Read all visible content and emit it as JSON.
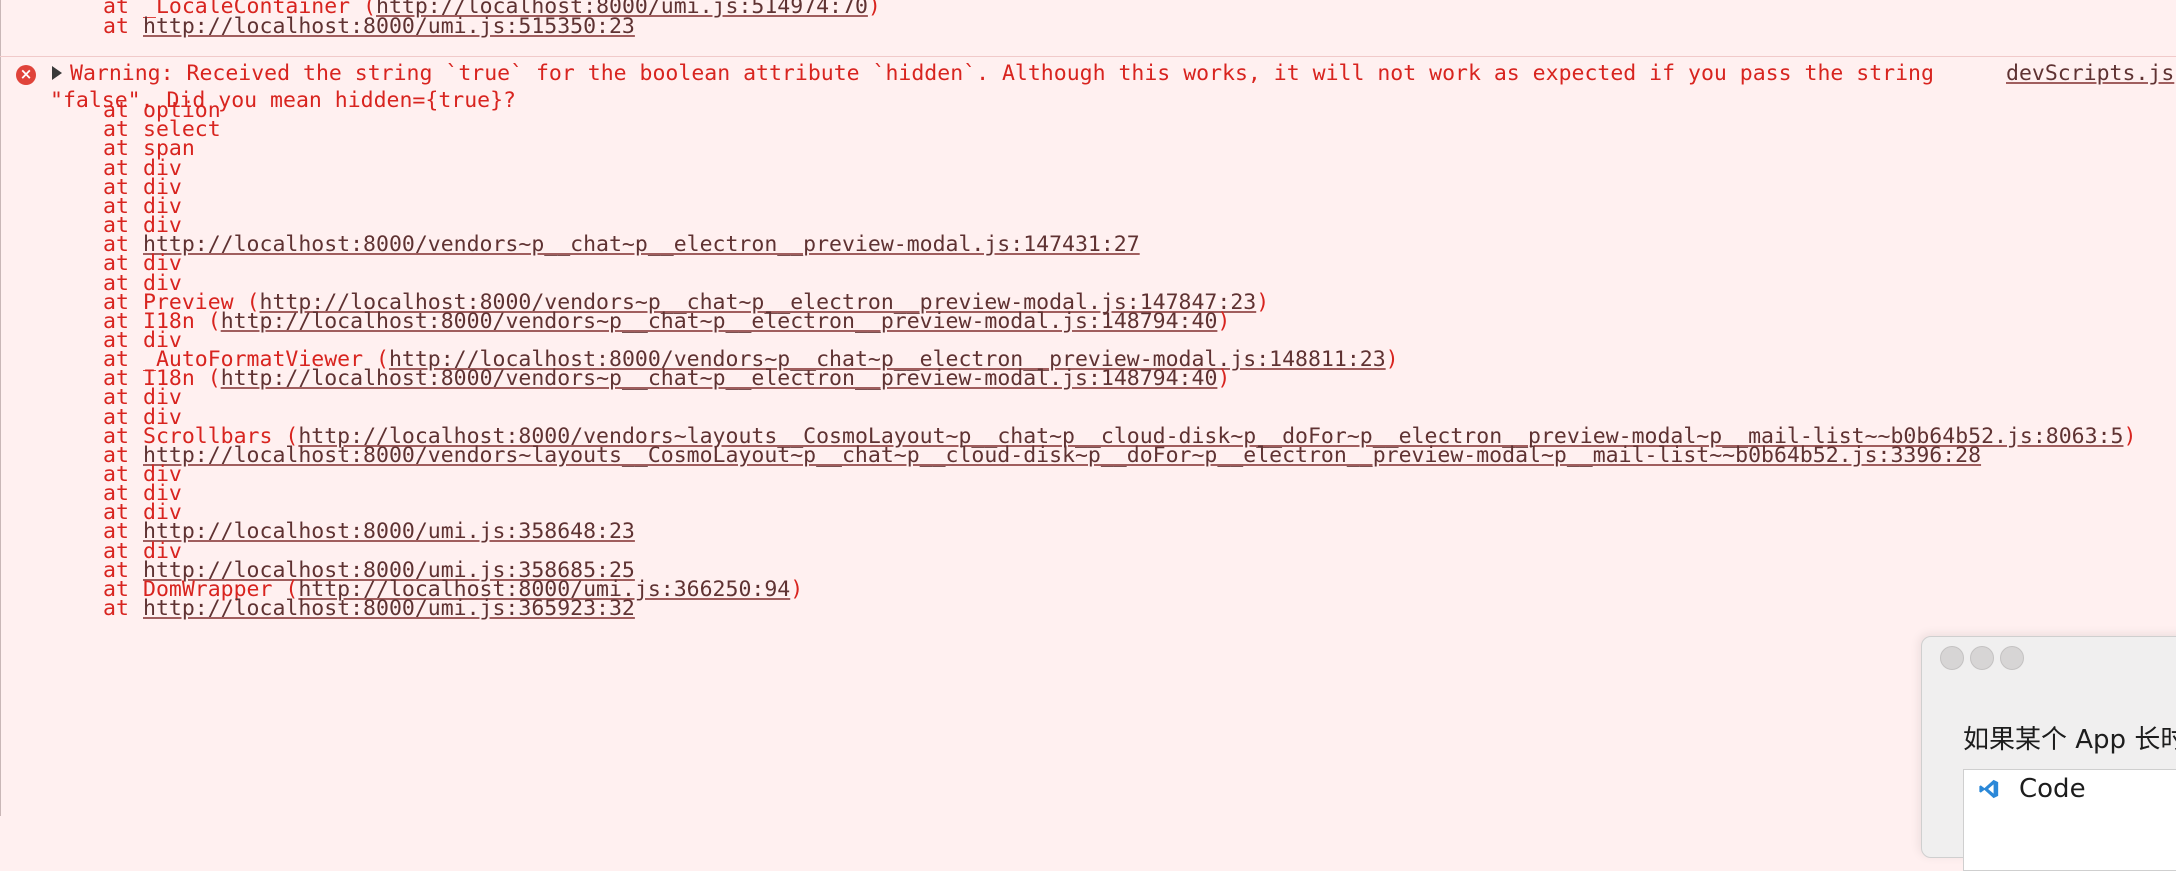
{
  "console": {
    "top_lines": [
      {
        "prefix": "at ",
        "name": "_LocaleContainer ",
        "link": "http://localhost:8000/umi.js:514974:70",
        "suffix": ")",
        "paren": "("
      },
      {
        "prefix": "at ",
        "name": "",
        "link": "http://localhost:8000/umi.js:515350:23",
        "suffix": "",
        "paren": ""
      }
    ],
    "warning": {
      "line1": "Warning: Received the string `true` for the boolean attribute `hidden`. Although this works, it will not work as expected if you pass the string",
      "line2": "\"false\". Did you mean hidden={true}?",
      "source": "devScripts.js",
      "error_symbol": "×"
    },
    "stack": [
      {
        "prefix": "at ",
        "name": "option",
        "link": "",
        "paren": "",
        "suffix": ""
      },
      {
        "prefix": "at ",
        "name": "select",
        "link": "",
        "paren": "",
        "suffix": ""
      },
      {
        "prefix": "at ",
        "name": "span",
        "link": "",
        "paren": "",
        "suffix": ""
      },
      {
        "prefix": "at ",
        "name": "div",
        "link": "",
        "paren": "",
        "suffix": ""
      },
      {
        "prefix": "at ",
        "name": "div",
        "link": "",
        "paren": "",
        "suffix": ""
      },
      {
        "prefix": "at ",
        "name": "div",
        "link": "",
        "paren": "",
        "suffix": ""
      },
      {
        "prefix": "at ",
        "name": "div",
        "link": "",
        "paren": "",
        "suffix": ""
      },
      {
        "prefix": "at ",
        "name": "",
        "link": "http://localhost:8000/vendors~p__chat~p__electron__preview-modal.js:147431:27",
        "paren": "",
        "suffix": ""
      },
      {
        "prefix": "at ",
        "name": "div",
        "link": "",
        "paren": "",
        "suffix": ""
      },
      {
        "prefix": "at ",
        "name": "div",
        "link": "",
        "paren": "",
        "suffix": ""
      },
      {
        "prefix": "at ",
        "name": "Preview ",
        "link": "http://localhost:8000/vendors~p__chat~p__electron__preview-modal.js:147847:23",
        "paren": "(",
        "suffix": ")"
      },
      {
        "prefix": "at ",
        "name": "I18n ",
        "link": "http://localhost:8000/vendors~p__chat~p__electron__preview-modal.js:148794:40",
        "paren": "(",
        "suffix": ")"
      },
      {
        "prefix": "at ",
        "name": "div",
        "link": "",
        "paren": "",
        "suffix": ""
      },
      {
        "prefix": "at ",
        "name": "_AutoFormatViewer ",
        "link": "http://localhost:8000/vendors~p__chat~p__electron__preview-modal.js:148811:23",
        "paren": "(",
        "suffix": ")"
      },
      {
        "prefix": "at ",
        "name": "I18n ",
        "link": "http://localhost:8000/vendors~p__chat~p__electron__preview-modal.js:148794:40",
        "paren": "(",
        "suffix": ")"
      },
      {
        "prefix": "at ",
        "name": "div",
        "link": "",
        "paren": "",
        "suffix": ""
      },
      {
        "prefix": "at ",
        "name": "div",
        "link": "",
        "paren": "",
        "suffix": ""
      },
      {
        "prefix": "at ",
        "name": "Scrollbars ",
        "link": "http://localhost:8000/vendors~layouts__CosmoLayout~p__chat~p__cloud-disk~p__doFor~p__electron__preview-modal~p__mail-list~~b0b64b52.js:8063:5",
        "paren": "(",
        "suffix": ")"
      },
      {
        "prefix": "at ",
        "name": "",
        "link": "http://localhost:8000/vendors~layouts__CosmoLayout~p__chat~p__cloud-disk~p__doFor~p__electron__preview-modal~p__mail-list~~b0b64b52.js:3396:28",
        "paren": "",
        "suffix": ""
      },
      {
        "prefix": "at ",
        "name": "div",
        "link": "",
        "paren": "",
        "suffix": ""
      },
      {
        "prefix": "at ",
        "name": "div",
        "link": "",
        "paren": "",
        "suffix": ""
      },
      {
        "prefix": "at ",
        "name": "div",
        "link": "",
        "paren": "",
        "suffix": ""
      },
      {
        "prefix": "at ",
        "name": "",
        "link": "http://localhost:8000/umi.js:358648:23",
        "paren": "",
        "suffix": ""
      },
      {
        "prefix": "at ",
        "name": "div",
        "link": "",
        "paren": "",
        "suffix": ""
      },
      {
        "prefix": "at ",
        "name": "",
        "link": "http://localhost:8000/umi.js:358685:25",
        "paren": "",
        "suffix": ""
      },
      {
        "prefix": "at ",
        "name": "DomWrapper ",
        "link": "http://localhost:8000/umi.js:366250:94",
        "paren": "(",
        "suffix": ")"
      },
      {
        "prefix": "at ",
        "name": "",
        "link": "http://localhost:8000/umi.js:365923:32",
        "paren": "",
        "suffix": ""
      }
    ]
  },
  "dialog": {
    "text": "如果某个 App 长时",
    "app_name": "Code",
    "app_icon": "vscode-icon"
  },
  "colors": {
    "error_text": "#d8241f",
    "background": "#fff0f0",
    "link": "#5f3232"
  }
}
